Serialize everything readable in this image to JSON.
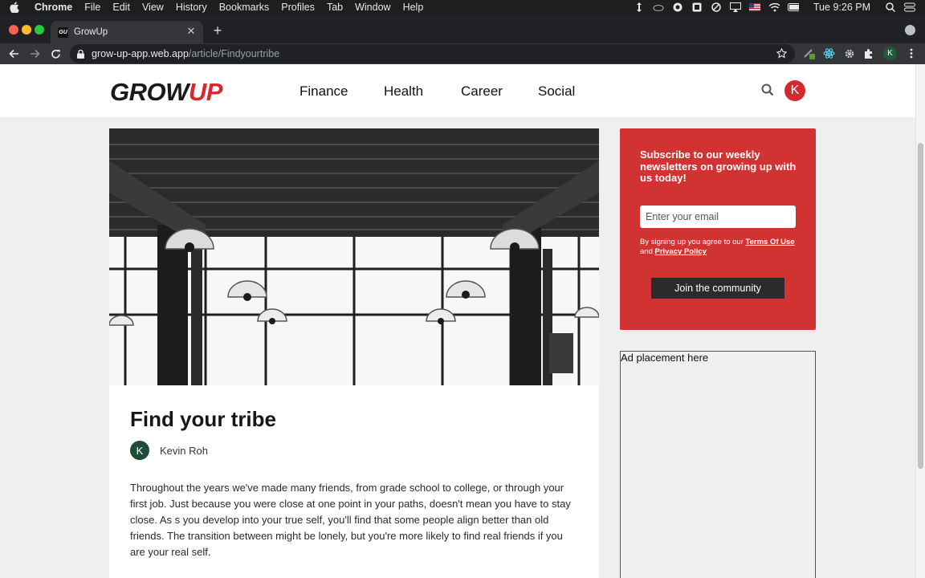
{
  "menubar": {
    "app": "Chrome",
    "items": [
      "File",
      "Edit",
      "View",
      "History",
      "Bookmarks",
      "Profiles",
      "Tab",
      "Window",
      "Help"
    ],
    "clock": "Tue 9:26 PM",
    "status_icons": [
      "arrows-icon",
      "cloud-icon",
      "record-icon",
      "square-icon",
      "block-icon",
      "airplay-icon",
      "flag-icon",
      "wifi-icon",
      "battery-icon",
      "search-icon",
      "control-center-icon"
    ]
  },
  "browser": {
    "tab_title": "GrowUp",
    "favicon_text": "GU",
    "url_host": "grow-up-app.web.app",
    "url_path": "/article/Findyourtribe",
    "profile_initial": "K"
  },
  "site": {
    "logo_main": "GROW",
    "logo_accent": "UP",
    "nav": [
      "Finance",
      "Health",
      "Career",
      "Social"
    ],
    "avatar_initial": "K",
    "colors": {
      "brand_red": "#d42a2f",
      "newsletter_red": "#d13333",
      "author_green": "#1f4b38"
    }
  },
  "article": {
    "title": "Find your tribe",
    "author_initial": "K",
    "author_name": "Kevin Roh",
    "body": "Throughout the years we've made many friends, from grade school to college, or through your first job. Just because you were close at one point in your paths, doesn't mean you have to stay close. As s you develop into your true self, you'll find that some people align better than old friends. The transition between might be lonely, but you're more likely to find real friends if you are your real self."
  },
  "newsletter": {
    "heading": "Subscribe to our weekly newsletters on growing up with us today!",
    "email_placeholder": "Enter your email",
    "terms_prefix": "By signing up you agree to our ",
    "terms_link": "Terms Of Use",
    "terms_and": " and ",
    "privacy_link": "Privacy Policy",
    "button": "Join the community"
  },
  "ad": {
    "label": "Ad placement here"
  }
}
